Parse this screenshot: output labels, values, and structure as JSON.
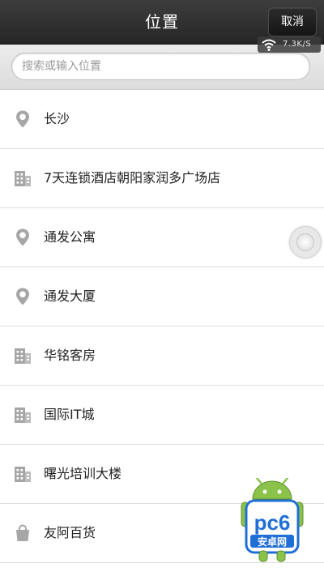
{
  "header": {
    "title": "位置",
    "cancel_label": "取消"
  },
  "status": {
    "network_speed": "7.3K/S"
  },
  "search": {
    "placeholder": "搜索或输入位置",
    "value": ""
  },
  "locations": [
    {
      "label": "长沙",
      "icon": "map-pin-icon"
    },
    {
      "label": "7天连锁酒店朝阳家润多广场店",
      "icon": "building-icon"
    },
    {
      "label": "通发公寓",
      "icon": "map-pin-icon"
    },
    {
      "label": "通发大厦",
      "icon": "map-pin-icon"
    },
    {
      "label": "华铭客房",
      "icon": "building-icon"
    },
    {
      "label": "国际IT城",
      "icon": "building-icon"
    },
    {
      "label": "曙光培训大楼",
      "icon": "building-icon"
    },
    {
      "label": "友阿百货",
      "icon": "shopping-bag-icon"
    }
  ],
  "watermark": {
    "brand": "pc6",
    "subtitle": "安卓网",
    "brand_color": "#1f6fd6",
    "android_color": "#8bc34a"
  },
  "colors": {
    "titlebar": "#2e2e2e",
    "icon_gray": "#a6a6a6",
    "divider": "#dedede"
  }
}
